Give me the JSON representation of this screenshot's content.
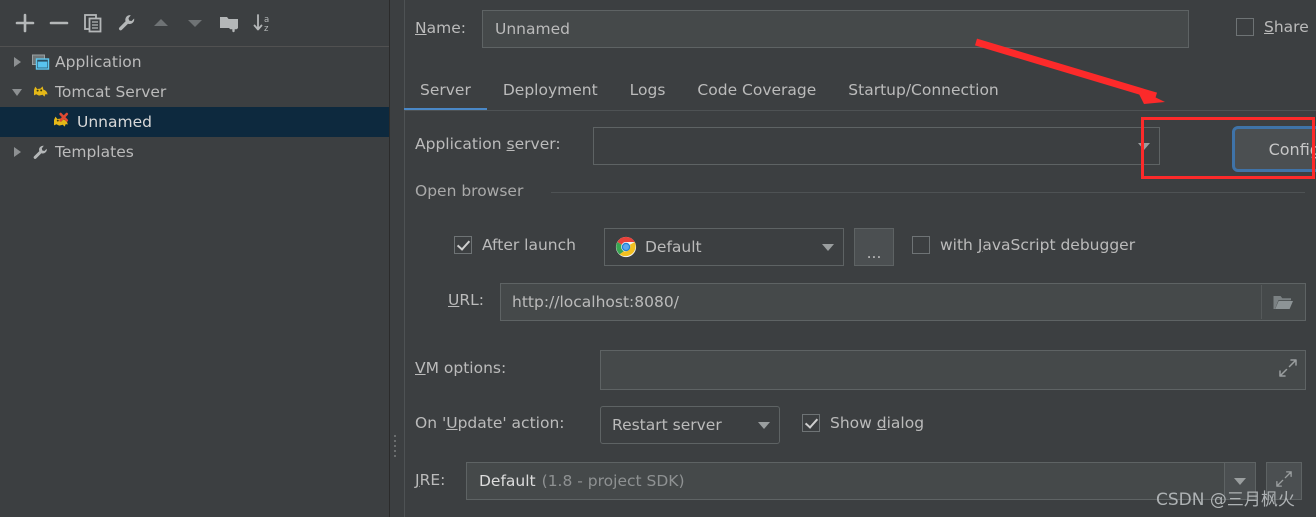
{
  "colors": {
    "background": "#3c3f41",
    "field_background": "#45494a",
    "border": "#5e6364",
    "text": "#bbbbbb",
    "tab_active_underline": "#4a88c7",
    "selection_background": "#0d293e",
    "focus_ring": "#3f73a8",
    "annotation_red": "#fc2a2a"
  },
  "toolbar": {
    "buttons": [
      {
        "name": "add-button",
        "icon": "plus-icon",
        "tooltip": "Add New Configuration"
      },
      {
        "name": "remove-button",
        "icon": "minus-icon",
        "tooltip": "Remove Configuration"
      },
      {
        "name": "copy-button",
        "icon": "copy-icon",
        "tooltip": "Copy Configuration"
      },
      {
        "name": "edit-templates-button",
        "icon": "wrench-icon",
        "tooltip": "Edit Templates"
      },
      {
        "name": "move-up-button",
        "icon": "arrow-up-icon",
        "tooltip": "Move Up"
      },
      {
        "name": "move-down-button",
        "icon": "arrow-down-icon",
        "tooltip": "Move Down"
      },
      {
        "name": "new-folder-button",
        "icon": "folder-add-icon",
        "tooltip": "Create New Folder"
      },
      {
        "name": "sort-button",
        "icon": "sort-az-icon",
        "tooltip": "Sort Configurations"
      }
    ]
  },
  "tree": {
    "nodes": [
      {
        "label": "Application",
        "icon": "application-icon",
        "expanded": false,
        "depth": 0,
        "selected": false,
        "has_arrow": true
      },
      {
        "label": "Tomcat Server",
        "icon": "tomcat-icon",
        "expanded": true,
        "depth": 0,
        "selected": false,
        "has_arrow": true
      },
      {
        "label": "Unnamed",
        "icon": "tomcat-error-icon",
        "expanded": false,
        "depth": 1,
        "selected": true,
        "has_arrow": false
      },
      {
        "label": "Templates",
        "icon": "wrench-icon",
        "expanded": false,
        "depth": 0,
        "selected": false,
        "has_arrow": true
      }
    ]
  },
  "header": {
    "name_label": "Name:",
    "name_mnemonic": "N",
    "name_label_rest": "ame:",
    "name_value": "Unnamed",
    "share_label": "Share",
    "share_mnemonic": "S",
    "share_label_rest": "hare",
    "share_checked": false
  },
  "tabs": {
    "items": [
      {
        "label": "Server",
        "active": true
      },
      {
        "label": "Deployment",
        "active": false
      },
      {
        "label": "Logs",
        "active": false
      },
      {
        "label": "Code Coverage",
        "active": false
      },
      {
        "label": "Startup/Connection",
        "active": false
      }
    ]
  },
  "server_tab": {
    "application_server": {
      "label_a": "Application ",
      "label_mnemonic": "s",
      "label_b": "erver:",
      "value": "",
      "configure_button": "Configure..."
    },
    "open_browser": {
      "group_title": "Open browser",
      "after_launch_label": "After launch",
      "after_launch_checked": true,
      "browser_value": "Default",
      "browser_icon": "chrome-icon",
      "browse_button": "...",
      "js_debugger_label_a": "with ",
      "js_debugger_mnemonic": "J",
      "js_debugger_label_b": "avaScript debugger",
      "js_debugger_checked": false,
      "url_label_mnemonic": "U",
      "url_label_rest": "RL:",
      "url_value": "http://localhost:8080/",
      "url_browse_icon": "folder-open-icon"
    },
    "vm_options": {
      "label_mnemonic": "V",
      "label_rest": "M options:",
      "value": "",
      "expand_icon": "expand-icon"
    },
    "on_update_action": {
      "label_a": "On '",
      "label_mnemonic": "U",
      "label_b": "pdate' action:",
      "value": "Restart server",
      "show_dialog_label_a": "Show ",
      "show_dialog_mnemonic": "d",
      "show_dialog_label_b": "ialog",
      "show_dialog_checked": true
    },
    "jre": {
      "label_mnemonic": "J",
      "label_rest": "RE:",
      "value": "Default",
      "value_detail": "(1.8 - project SDK)",
      "dropdown_icon": "caret-down-icon",
      "expand_icon": "expand-icon"
    }
  },
  "watermark": {
    "text": "CSDN @三月枫火"
  }
}
